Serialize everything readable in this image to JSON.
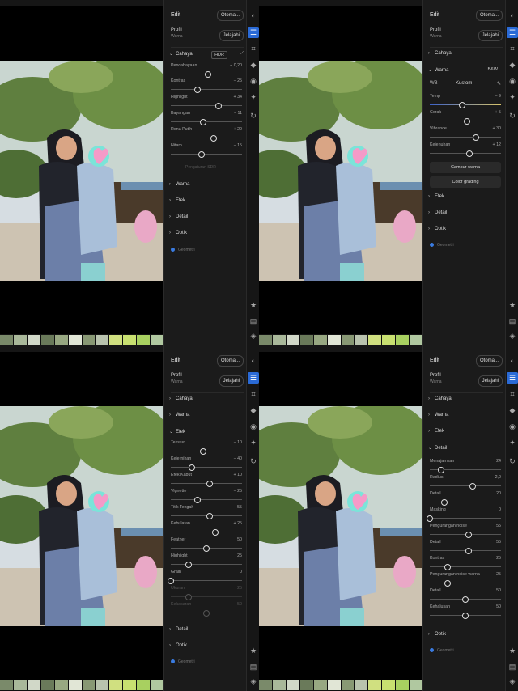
{
  "common": {
    "edit_title": "Edit",
    "auto_button": "Otoma...",
    "profile_label": "Profil",
    "profile_value": "Warna",
    "browse_button": "Jelajahi",
    "geometri": "Geometri"
  },
  "sections": {
    "cahaya": "Cahaya",
    "warna": "Warna",
    "efek": "Efek",
    "detail": "Detail",
    "optik": "Optik"
  },
  "q1": {
    "hdr_label": "HDR",
    "sliders": [
      {
        "label": "Pencahayaan",
        "value": "+ 0,20",
        "pos": 0.52
      },
      {
        "label": "Kontras",
        "value": "− 25",
        "pos": 0.38
      },
      {
        "label": "Highlight",
        "value": "+ 34",
        "pos": 0.67
      },
      {
        "label": "Bayangan",
        "value": "− 11",
        "pos": 0.45
      },
      {
        "label": "Rona Putih",
        "value": "+ 20",
        "pos": 0.6
      },
      {
        "label": "Hitam",
        "value": "− 15",
        "pos": 0.43
      }
    ],
    "sdr_label": "Pengaturan SDR"
  },
  "q2": {
    "bw_label": "B&W",
    "wb_label": "WB",
    "wb_value": "Kustom",
    "sliders": [
      {
        "label": "Temp",
        "value": "− 9",
        "pos": 0.46
      },
      {
        "label": "Corak",
        "value": "+ 5",
        "pos": 0.52
      },
      {
        "label": "Vibrance",
        "value": "+ 30",
        "pos": 0.65
      },
      {
        "label": "Kejenuhan",
        "value": "+ 12",
        "pos": 0.56
      }
    ],
    "color_mix": "Campur warna",
    "color_grading": "Color grading"
  },
  "q3": {
    "sliders": [
      {
        "label": "Tekstur",
        "value": "− 10",
        "pos": 0.45
      },
      {
        "label": "Kejernihan",
        "value": "− 40",
        "pos": 0.3
      },
      {
        "label": "Efek Kabut",
        "value": "+ 10",
        "pos": 0.55
      },
      {
        "label": "Vignette",
        "value": "− 25",
        "pos": 0.38
      },
      {
        "label": "Titik Tengah",
        "value": "55",
        "pos": 0.55
      },
      {
        "label": "Kebulatan",
        "value": "+ 25",
        "pos": 0.62
      },
      {
        "label": "Feather",
        "value": "50",
        "pos": 0.5
      },
      {
        "label": "Highlight",
        "value": "25",
        "pos": 0.25
      },
      {
        "label": "Grain",
        "value": "0",
        "pos": 0.0
      },
      {
        "label": "Ukuran",
        "value": "25",
        "pos": 0.25,
        "dim": true
      },
      {
        "label": "Kekasaran",
        "value": "50",
        "pos": 0.5,
        "dim": true
      }
    ]
  },
  "q4": {
    "sliders": [
      {
        "label": "Menajamkan",
        "value": "24",
        "pos": 0.16
      },
      {
        "label": "Radius",
        "value": "2,0",
        "pos": 0.6
      },
      {
        "label": "Detail",
        "value": "20",
        "pos": 0.2
      },
      {
        "label": "Masking",
        "value": "0",
        "pos": 0.0
      },
      {
        "label": "Pengurangan noise",
        "value": "55",
        "pos": 0.55
      },
      {
        "label": "Detail",
        "value": "55",
        "pos": 0.55
      },
      {
        "label": "Kontras",
        "value": "25",
        "pos": 0.25
      },
      {
        "label": "Pengurangan noise warna",
        "value": "25",
        "pos": 0.25
      },
      {
        "label": "Detail",
        "value": "50",
        "pos": 0.5
      },
      {
        "label": "Kehalusan",
        "value": "50",
        "pos": 0.5
      }
    ]
  },
  "colors": {
    "accent": "#2a6ad6",
    "panel": "#1b1b1b"
  }
}
